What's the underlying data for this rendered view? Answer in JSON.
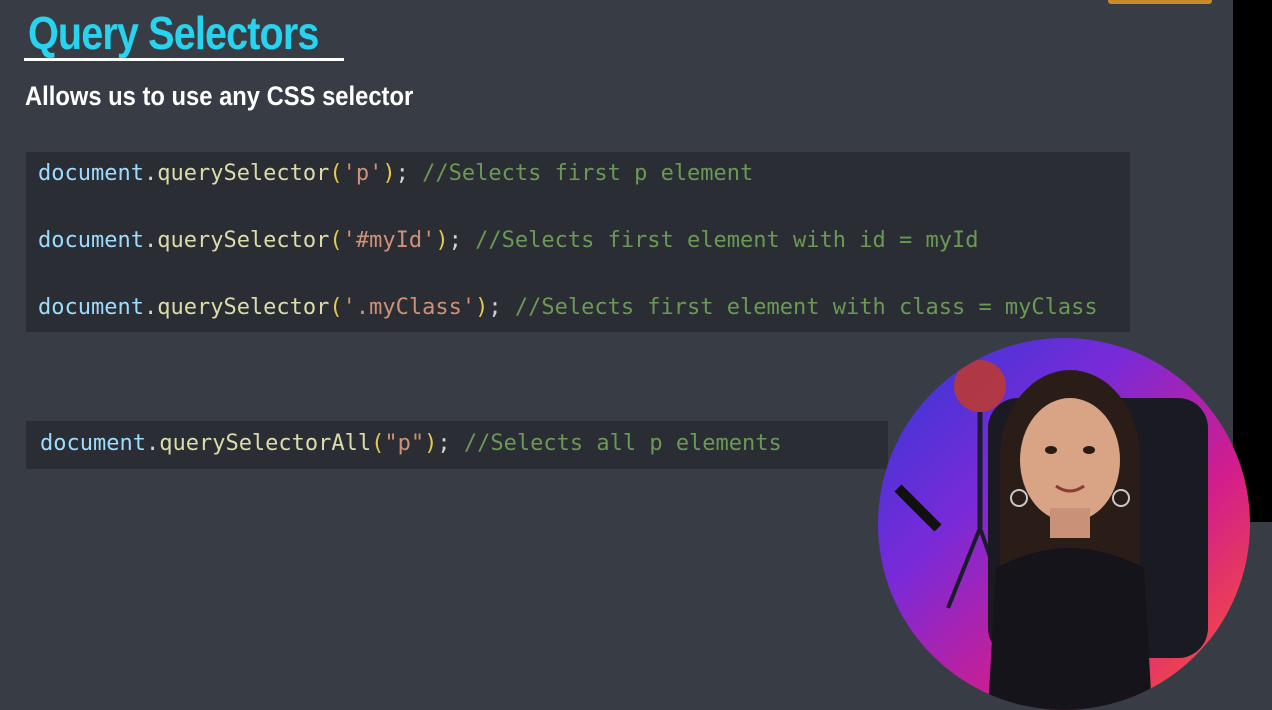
{
  "slide": {
    "title": "Query Selectors",
    "subtitle": "Allows us to use any CSS selector"
  },
  "code_lines": [
    {
      "obj": "document",
      "dot": ".",
      "fn": "querySelector",
      "open": "(",
      "arg": "'p'",
      "close": ")",
      "semi": ";",
      "comment": "//Selects first p element"
    },
    {
      "obj": "document",
      "dot": ".",
      "fn": "querySelector",
      "open": "(",
      "arg": "'#myId'",
      "close": ")",
      "semi": ";",
      "comment": "//Selects first element with id = myId"
    },
    {
      "obj": "document",
      "dot": ".",
      "fn": "querySelector",
      "open": "(",
      "arg": "'.myClass'",
      "close": ")",
      "semi": ";",
      "comment": "//Selects first element with class = myClass"
    }
  ],
  "code_line_all": {
    "obj": "document",
    "dot": ".",
    "fn": "querySelectorAll",
    "open": "(",
    "arg": "\"p\"",
    "close": ")",
    "semi": ";",
    "comment": "//Selects all p elements"
  },
  "colors": {
    "background": "#383d45",
    "code_background": "#2a2d33",
    "title": "#27d3ee",
    "comment": "#6a9955",
    "string": "#ce9178",
    "function": "#dcdcaa",
    "object": "#9cdcfe"
  },
  "icons": [
    "presenter-webcam-image"
  ]
}
